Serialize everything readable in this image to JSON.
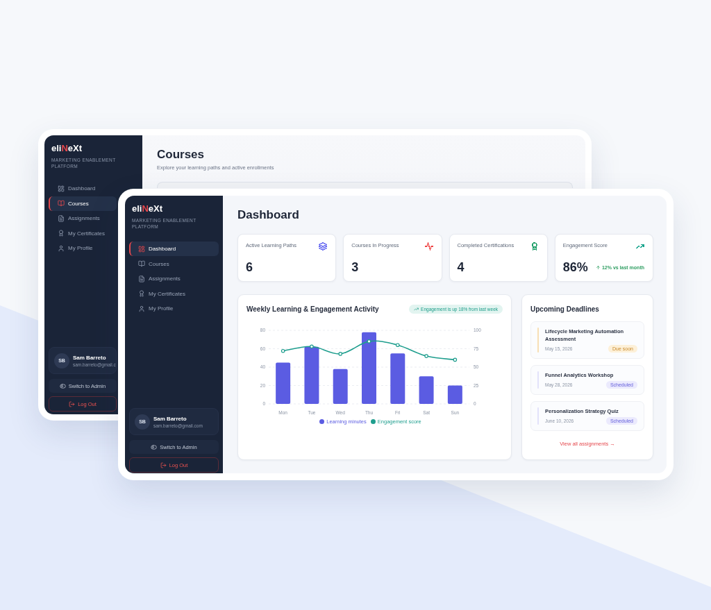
{
  "back_window": {
    "sidebar": {
      "logo": [
        {
          "text": "eli",
          "accent": false
        },
        {
          "text": "N",
          "accent": true
        },
        {
          "text": "eXt",
          "accent": false
        }
      ],
      "tagline": "MARKETING ENABLEMENT PLATFORM",
      "nav_items": [
        {
          "label": "Dashboard",
          "selected": false
        },
        {
          "label": "Courses",
          "selected": true
        },
        {
          "label": "Assignments",
          "selected": false
        },
        {
          "label": "My Certificates",
          "selected": false
        },
        {
          "label": "My Profile",
          "selected": false
        }
      ],
      "user": {
        "initials": "SB",
        "name": "Sam Barreto",
        "email": "sam.barreto@gmail.c"
      },
      "switch_button": "Switch to Admin",
      "logout_button": "Log Out"
    },
    "page": {
      "title": "Courses",
      "subtitle": "Explore your learning paths and active enrollments"
    }
  },
  "front_window": {
    "sidebar": {
      "logo": [
        {
          "text": "eli",
          "accent": false
        },
        {
          "text": "N",
          "accent": true
        },
        {
          "text": "eXt",
          "accent": false
        }
      ],
      "tagline": "MARKETING ENABLEMENT PLATFORM",
      "nav_items": [
        {
          "label": "Dashboard",
          "selected": true
        },
        {
          "label": "Courses",
          "selected": false
        },
        {
          "label": "Assignments",
          "selected": false
        },
        {
          "label": "My Certificates",
          "selected": false
        },
        {
          "label": "My Profile",
          "selected": false
        }
      ],
      "user": {
        "initials": "SB",
        "name": "Sam Barreto",
        "email": "sam.barreto@gmail.com"
      },
      "switch_button": "Switch to Admin",
      "logout_button": "Log Out"
    },
    "page": {
      "title": "Dashboard",
      "stats": [
        {
          "label": "Active Learning Paths",
          "value": "6",
          "color": "#6366f1"
        },
        {
          "label": "Courses In Progress",
          "value": "3",
          "color": "#ef4444"
        },
        {
          "label": "Completed Certifications",
          "value": "4",
          "color": "#22a06b"
        },
        {
          "label": "Engagement Score",
          "value": "86%",
          "color": "#14a38b",
          "trend": "12% vs last month"
        }
      ],
      "activity_chart": {
        "title": "Weekly Learning & Engagement Activity",
        "badge": "Engagement is up 18% from last week",
        "chart_data": {
          "type": "bar",
          "categories": [
            "Mon",
            "Tue",
            "Wed",
            "Thu",
            "Fri",
            "Sat",
            "Sun"
          ],
          "series": [
            {
              "name": "Learning minutes",
              "color": "#5b5ce2",
              "values": [
                45,
                62,
                38,
                78,
                55,
                30,
                20
              ]
            },
            {
              "name": "Engagement score",
              "type": "line",
              "axis": "y2",
              "marker": "o",
              "color": "#1f9e8e",
              "values": [
                72,
                78,
                68,
                85,
                80,
                65,
                60
              ]
            }
          ],
          "ylim": [
            0,
            80
          ],
          "yticks": [
            0,
            20,
            40,
            60,
            80
          ],
          "y2lim": [
            0,
            100
          ],
          "y2ticks": [
            0,
            25,
            50,
            75,
            100
          ],
          "grid": true
        }
      },
      "deadlines": {
        "title": "Upcoming Deadlines",
        "items": [
          {
            "title": "Lifecycle Marketing Automation Assessment",
            "date": "May 15, 2026",
            "status": "Due soon",
            "kind": "due_soon"
          },
          {
            "title": "Funnel Analytics Workshop",
            "date": "May 28, 2026",
            "status": "Scheduled",
            "kind": "scheduled"
          },
          {
            "title": "Personalization Strategy Quiz",
            "date": "June 10, 2026",
            "status": "Scheduled",
            "kind": "scheduled"
          }
        ],
        "link": "View all assignments →"
      }
    }
  }
}
